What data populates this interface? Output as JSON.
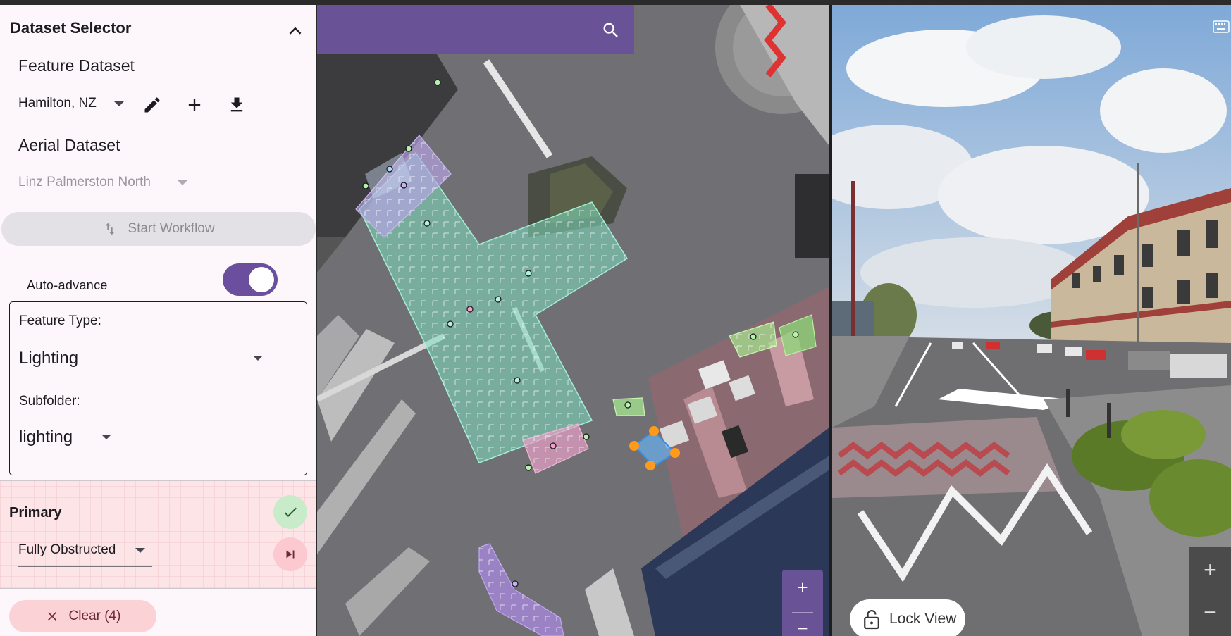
{
  "panel": {
    "title": "Dataset Selector",
    "feature_dataset_label": "Feature Dataset",
    "feature_dataset_value": "Hamilton, NZ",
    "aerial_dataset_label": "Aerial Dataset",
    "aerial_dataset_value": "Linz Palmerston North",
    "workflow_button": "Start Workflow",
    "auto_advance_label": "Auto-advance",
    "auto_advance_on": true,
    "feature_type_label": "Feature Type:",
    "feature_type_value": "Lighting",
    "subfolder_label": "Subfolder:",
    "subfolder_value": "lighting",
    "primary_label": "Primary",
    "obstruction_value": "Fully Obstructed",
    "clear_button": "Clear (4)"
  },
  "icons": [
    "chevron-up-icon",
    "dropdown-caret-icon",
    "pencil-icon",
    "plus-icon",
    "download-icon",
    "swap-vertical-icon",
    "check-icon",
    "skip-next-icon",
    "close-icon",
    "search-icon",
    "lock-icon",
    "keyboard-icon"
  ],
  "map": {
    "zoom_in": "+",
    "zoom_out": "−"
  },
  "street_view": {
    "lock_button": "Lock View",
    "zoom_in": "+",
    "zoom_out": "−"
  },
  "colors": {
    "accent_purple": "#6a5296",
    "toggle_purple": "#6b4f9e",
    "panel_bg": "#fdf7fc",
    "primary_bg": "#fde4e7",
    "check_green": "#c8ecc9",
    "skip_pink": "#fbd3d6",
    "teal_polygon": "#7fe0c0",
    "violet_polygon": "#b9a4e8",
    "pink_polygon": "#e8a0c8",
    "green_polygon": "#a8e890",
    "selected_orange": "#ff9a1a"
  }
}
